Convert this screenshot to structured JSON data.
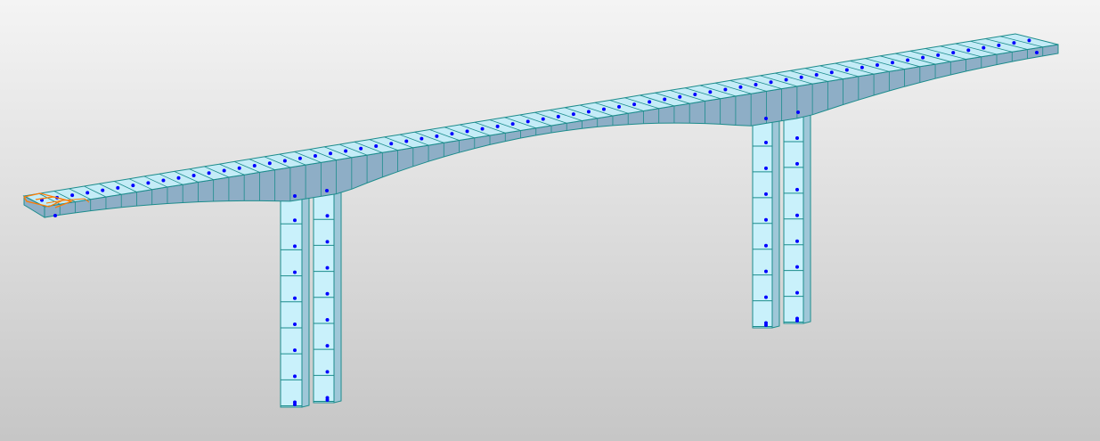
{
  "viewport": {
    "type": "3d-structural-model-view",
    "model": "bridge",
    "deck_segments": 66,
    "pier_pairs": 2,
    "columns_per_pier": 2,
    "column_segments": 8,
    "selected_element": "left-abutment-end"
  },
  "colors": {
    "background_top": "#f4f4f4",
    "background_bottom": "#c6c6c6",
    "deck_top": "#c4ecf7",
    "deck_side": "#8eaec6",
    "pier_front": "#c9f1fb",
    "pier_side": "#9fc7d8",
    "edge": "#1c8c8c",
    "node": "#0000ff",
    "selection": "#ff7a00"
  }
}
